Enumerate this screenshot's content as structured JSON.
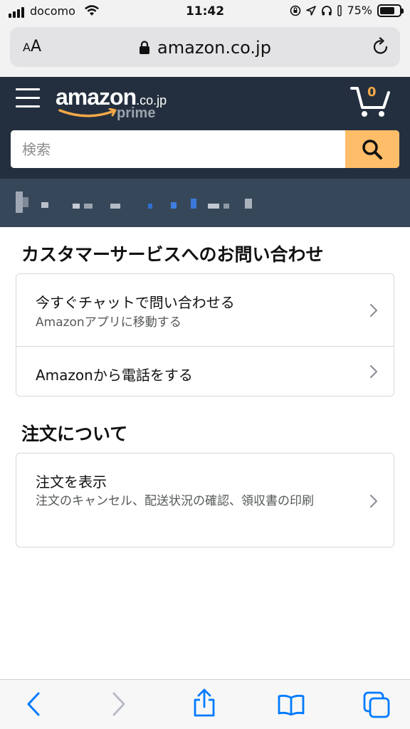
{
  "status_bar": {
    "carrier": "docomo",
    "time": "11:42",
    "battery_percent": "75%"
  },
  "browser": {
    "text_size_label": "AA",
    "url": "amazon.co.jp"
  },
  "header": {
    "logo_text": "amazon",
    "logo_domain": ".co.jp",
    "logo_sub": "prime",
    "cart_count": "0",
    "search_placeholder": "検索"
  },
  "sections": [
    {
      "title": "カスタマーサービスへのお問い合わせ",
      "items": [
        {
          "title": "今すぐチャットで問い合わせる",
          "subtitle": "Amazonアプリに移動する"
        },
        {
          "title": "Amazonから電話をする"
        }
      ]
    },
    {
      "title": "注文について",
      "items": [
        {
          "title": "注文を表示",
          "subtitle": "注文のキャンセル、配送状況の確認、領収書の印刷"
        }
      ]
    }
  ],
  "colors": {
    "header_bg": "#232f3e",
    "address_bg": "#37475a",
    "search_button": "#febd69",
    "cart_count": "#f3a847",
    "link_blue": "#007aff"
  },
  "icons": [
    "hamburger-icon",
    "cart-icon",
    "search-icon",
    "lock-icon",
    "reload-icon",
    "back-icon",
    "forward-icon",
    "share-icon",
    "bookmarks-icon",
    "tabs-icon"
  ]
}
